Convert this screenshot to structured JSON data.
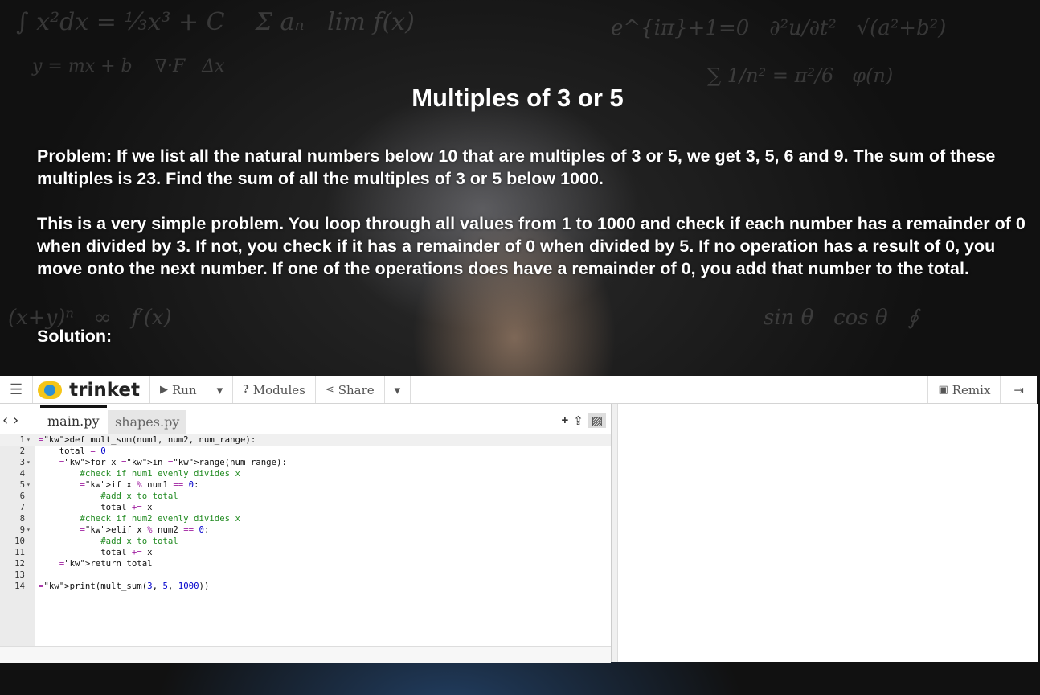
{
  "page": {
    "title": "Multiples of 3 or 5",
    "problem": "Problem: If we list all the natural numbers below 10 that are multiples of 3 or 5, we get 3, 5, 6 and 9. The sum of these multiples is 23. Find the sum of all the multiples of 3 or 5 below 1000.",
    "explanation": "This is a very simple problem. You loop through all values from 1 to 1000 and check if each number has a remainder of 0 when divided by 3. If not, you check if it has a remainder of 0 when divided by 5. If no operation has a result of 0, you move onto the next number. If one of the operations does have a remainder of 0, you add that number to the total.",
    "solution_label": "Solution:"
  },
  "trinket": {
    "logo": "trinket",
    "run_label": "Run",
    "modules_label": "Modules",
    "share_label": "Share",
    "remix_label": "Remix",
    "tabs": [
      "main.py",
      "shapes.py"
    ],
    "code_lines": [
      "def mult_sum(num1, num2, num_range):",
      "    total = 0",
      "    for x in range(num_range):",
      "        #check if num1 evenly divides x",
      "        if x % num1 == 0:",
      "            #add x to total",
      "            total += x",
      "        #check if num2 evenly divides x",
      "        elif x % num2 == 0:",
      "            #add x to total",
      "            total += x",
      "    return total",
      "",
      "print(mult_sum(3, 5, 1000))"
    ],
    "fold_lines": [
      1,
      3,
      5,
      9
    ],
    "colors": {
      "logo_yellow": "#f5c518",
      "logo_blue": "#2d8fd5",
      "keyword": "#8a2be2",
      "comment": "#228b22",
      "number": "#0000cd"
    }
  }
}
